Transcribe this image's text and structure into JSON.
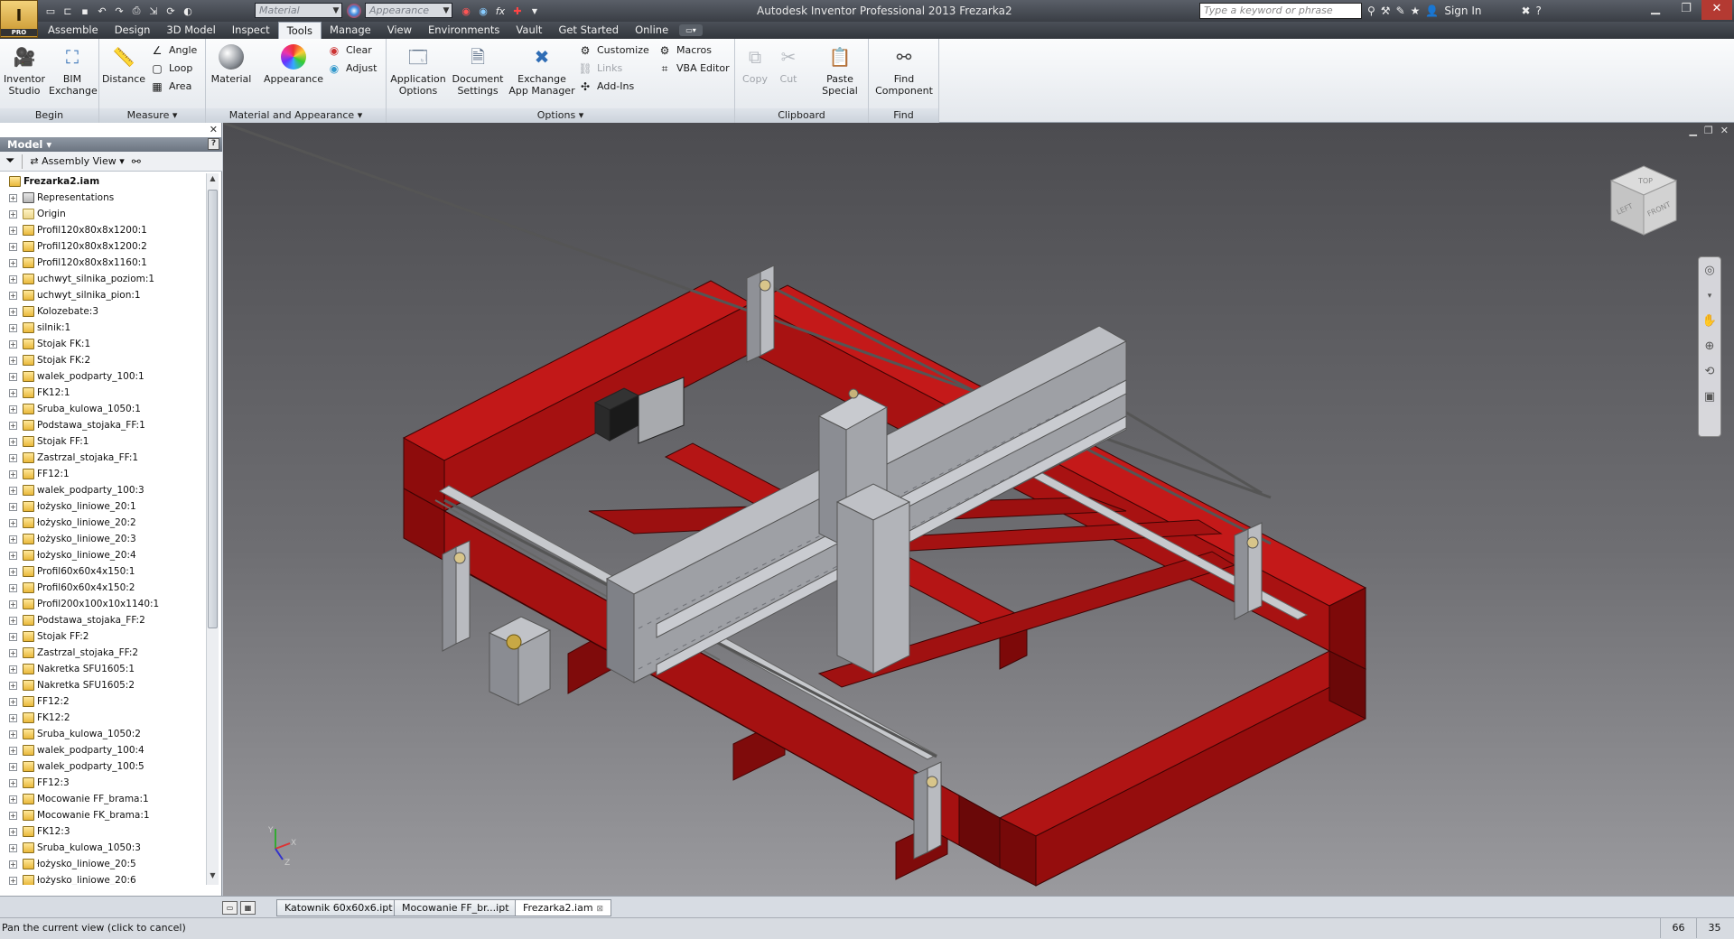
{
  "titlebar": {
    "logo": "I",
    "logo_badge": "PRO",
    "material_placeholder": "Material",
    "appearance_placeholder": "Appearance",
    "app_title": "Autodesk Inventor Professional 2013   Frezarka2",
    "search_placeholder": "Type a keyword or phrase",
    "sign_in": "Sign In"
  },
  "tabs": [
    "Assemble",
    "Design",
    "3D Model",
    "Inspect",
    "Tools",
    "Manage",
    "View",
    "Environments",
    "Vault",
    "Get Started",
    "Online"
  ],
  "active_tab": "Tools",
  "ribbon": {
    "begin": {
      "label": "Begin",
      "inventor_studio": "Inventor Studio",
      "bim_exchange": "BIM Exchange"
    },
    "measure": {
      "label": "Measure",
      "distance": "Distance",
      "angle": "Angle",
      "loop": "Loop",
      "area": "Area"
    },
    "material_appearance": {
      "label": "Material and Appearance",
      "material": "Material",
      "appearance": "Appearance",
      "clear": "Clear",
      "adjust": "Adjust"
    },
    "options": {
      "label": "Options",
      "application_options": "Application Options",
      "document_settings": "Document Settings",
      "exchange_app_manager": "Exchange App Manager",
      "customize": "Customize",
      "links": "Links",
      "add_ins": "Add-Ins",
      "macros": "Macros",
      "vba_editor": "VBA Editor"
    },
    "clipboard": {
      "label": "Clipboard",
      "copy": "Copy",
      "cut": "Cut",
      "paste_special": "Paste Special"
    },
    "find": {
      "label": "Find",
      "find_component": "Find Component"
    }
  },
  "browser": {
    "title": "Model",
    "view_mode": "Assembly View",
    "root": "Frezarka2.iam",
    "items": [
      "Representations",
      "Origin",
      "Profil120x80x8x1200:1",
      "Profil120x80x8x1200:2",
      "Profil120x80x8x1160:1",
      "uchwyt_silnika_poziom:1",
      "uchwyt_silnika_pion:1",
      "Kolozebate:3",
      "silnik:1",
      "Stojak FK:1",
      "Stojak FK:2",
      "walek_podparty_100:1",
      "FK12:1",
      "Sruba_kulowa_1050:1",
      "Podstawa_stojaka_FF:1",
      "Stojak FF:1",
      "Zastrzal_stojaka_FF:1",
      "FF12:1",
      "walek_podparty_100:3",
      "łożysko_liniowe_20:1",
      "łożysko_liniowe_20:2",
      "łożysko_liniowe_20:3",
      "łożysko_liniowe_20:4",
      "Profil60x60x4x150:1",
      "Profil60x60x4x150:2",
      "Profil200x100x10x1140:1",
      "Podstawa_stojaka_FF:2",
      "Stojak FF:2",
      "Zastrzal_stojaka_FF:2",
      "Nakretka SFU1605:1",
      "Nakretka SFU1605:2",
      "FF12:2",
      "FK12:2",
      "Sruba_kulowa_1050:2",
      "walek_podparty_100:4",
      "walek_podparty_100:5",
      "FF12:3",
      "Mocowanie FF_brama:1",
      "Mocowanie FK_brama:1",
      "FK12:3",
      "Sruba_kulowa_1050:3",
      "łożysko_liniowe_20:5",
      "łożysko_liniowe_20:6"
    ]
  },
  "viewcube": {
    "left": "LEFT",
    "front": "FRONT",
    "top": "TOP"
  },
  "doc_tabs": [
    "Katownik 60x60x6.ipt",
    "Mocowanie FF_br...ipt",
    "Frezarka2.iam"
  ],
  "active_doc_tab": "Frezarka2.iam",
  "status": {
    "text": "Pan the current view (click to cancel)",
    "count1": "66",
    "count2": "35"
  },
  "colors": {
    "frame_red": "#9b0f0f",
    "gantry_gray": "#a9abb0",
    "accent": "#2f6db5"
  }
}
